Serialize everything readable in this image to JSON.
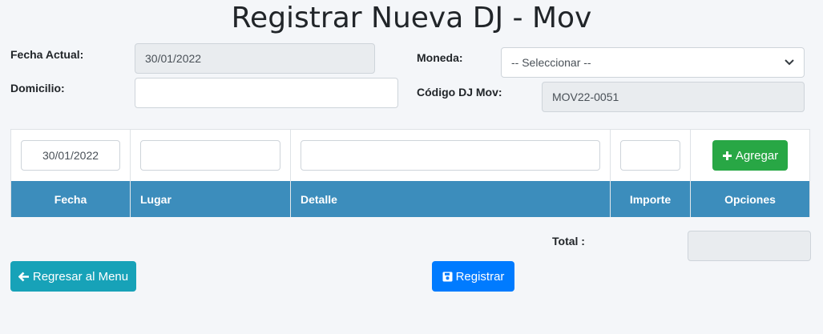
{
  "page": {
    "title": "Registrar Nueva DJ - Mov"
  },
  "form": {
    "fecha_actual_label": "Fecha Actual:",
    "fecha_actual_value": "30/01/2022",
    "domicilio_label": "Domicilio:",
    "domicilio_value": "",
    "moneda_label": "Moneda:",
    "moneda_value": "-- Seleccionar --",
    "codigo_label": "Código DJ Mov:",
    "codigo_value": "MOV22-0051"
  },
  "entry": {
    "fecha_value": "30/01/2022",
    "lugar_value": "",
    "detalle_value": "",
    "importe_value": "",
    "add_label": "Agregar"
  },
  "table": {
    "headers": [
      "Fecha",
      "Lugar",
      "Detalle",
      "Importe",
      "Opciones"
    ]
  },
  "footer": {
    "total_label": "Total :",
    "total_value": "",
    "back_label": "Regresar al Menu",
    "submit_label": "Registrar"
  },
  "colors": {
    "header_bg": "#3c8dbc",
    "green": "#28a745",
    "teal": "#17a2b8",
    "blue": "#007bff"
  },
  "icons": {
    "add": "plus-icon",
    "back": "arrow-left-icon",
    "submit": "save-icon"
  }
}
